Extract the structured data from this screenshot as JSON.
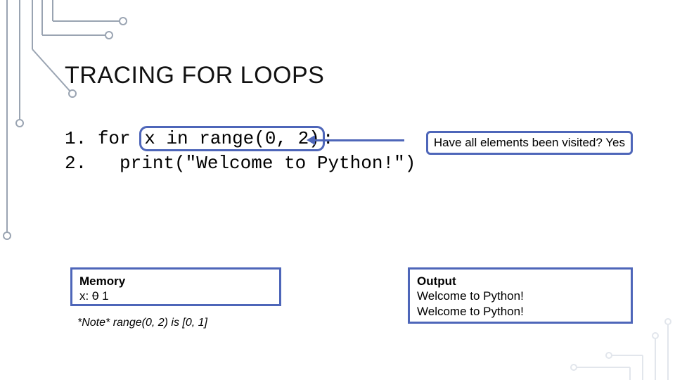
{
  "title": "TRACING FOR LOOPS",
  "code": {
    "ln1_num": "1.",
    "ln1_for": "for",
    "ln1_highlight": "x in range(0, 2)",
    "ln1_colon": ":",
    "ln2_num": "2.",
    "ln2_body": "  print(\"Welcome to Python!\")"
  },
  "callout": "Have all elements been visited? Yes",
  "memory": {
    "heading": "Memory",
    "var_label": "x:",
    "struck": "0",
    "current": "1"
  },
  "footnote": "*Note* range(0, 2) is [0, 1]",
  "output": {
    "heading": "Output",
    "line1": "Welcome to Python!",
    "line2": "Welcome to Python!"
  }
}
